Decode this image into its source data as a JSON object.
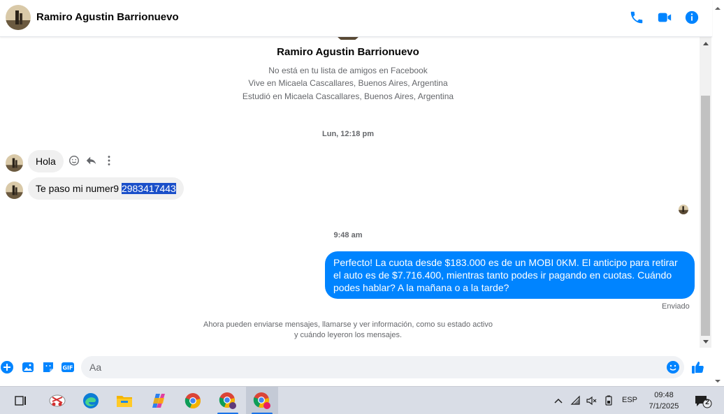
{
  "header": {
    "contact_name": "Ramiro Agustin Barrionuevo",
    "icons": [
      "phone-icon",
      "video-call-icon",
      "info-icon"
    ],
    "accent_color": "#0084ff"
  },
  "profile": {
    "name": "Ramiro Agustin Barrionuevo",
    "lines": [
      "No está en tu lista de amigos en Facebook",
      "Vive en Micaela Cascallares, Buenos Aires, Argentina",
      "Estudió en Micaela Cascallares, Buenos Aires, Argentina"
    ]
  },
  "messages": {
    "timestamp_1": "Lun, 12:18 pm",
    "incoming_1": "Hola",
    "incoming_2_text": "Te paso mi numer9 ",
    "incoming_2_highlight": "2983417443",
    "timestamp_2": "9:48 am",
    "outgoing_1": "Perfecto! La cuota desde $183.000 es de un MOBI 0KM. El anticipo para retirar el auto es de $7.716.400, mientras tanto podes ir pagando en cuotas. Cuándo podes hablar? A la mañana o a la tarde?",
    "status": "Enviado",
    "info_note_line1": "Ahora pueden enviarse mensajes, llamarse y ver información, como su estado activo",
    "info_note_line2": "y cuándo leyeron los mensajes."
  },
  "composer": {
    "placeholder": "Aa",
    "icons": [
      "plus-icon",
      "photo-icon",
      "sticker-icon",
      "gif-icon",
      "emoji-icon",
      "like-icon"
    ]
  },
  "taskbar": {
    "apps": [
      "task-view-icon",
      "snipping-tool-icon",
      "edge-icon",
      "file-explorer-icon",
      "copilot-icon",
      "chrome-icon",
      "chrome-profile-icon",
      "chrome-profile-active-icon"
    ],
    "language": "ESP",
    "time": "09:48",
    "date": "7/1/2025",
    "notification_count": "2"
  }
}
